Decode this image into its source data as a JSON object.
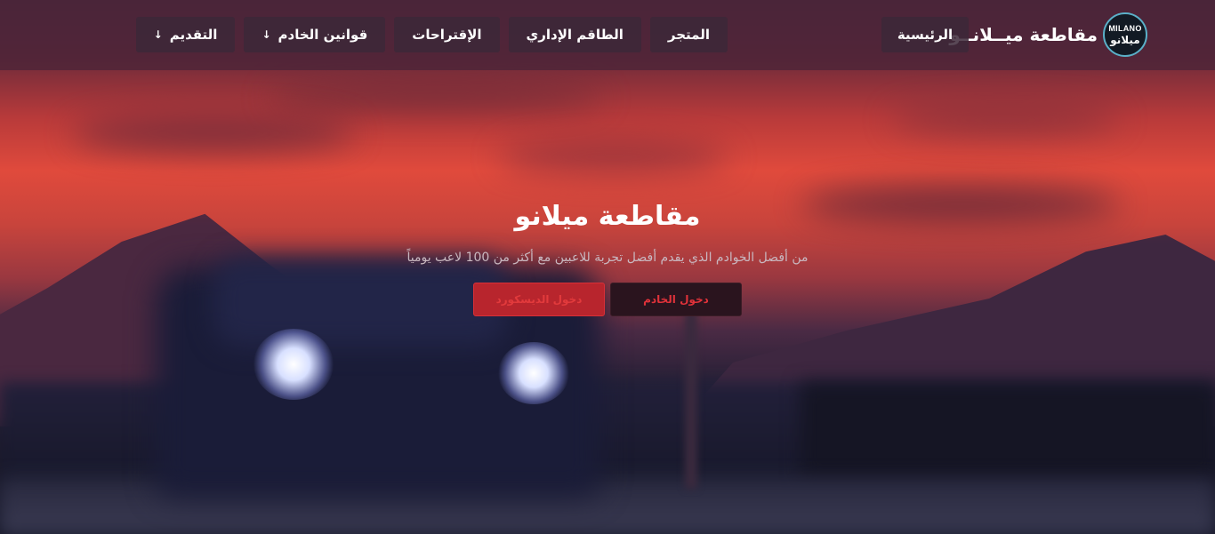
{
  "brand": {
    "title": "مقاطعة ميــلانــو",
    "logo_text_en": "MILANO",
    "logo_text_ar": "ميلانو"
  },
  "nav": {
    "home": "الرئيسية",
    "store": "المتجر",
    "staff": "الطاقم الإداري",
    "suggestions": "الإقتراحات",
    "rules": "قوانين الخادم",
    "apply": "التقديم",
    "dropdown_arrow": "↓"
  },
  "hero": {
    "title": "مقاطعة ميلانو",
    "subtitle": "من أفضل الخوادم الذي يقدم أفضل تجربة للاعبين مع أكثر من 100 لاعب يومياً",
    "join_server": "دخول الخادم",
    "join_discord": "دخول الديسكورد"
  },
  "colors": {
    "accent_red": "#e0323a",
    "header_bg": "#4a2438"
  }
}
